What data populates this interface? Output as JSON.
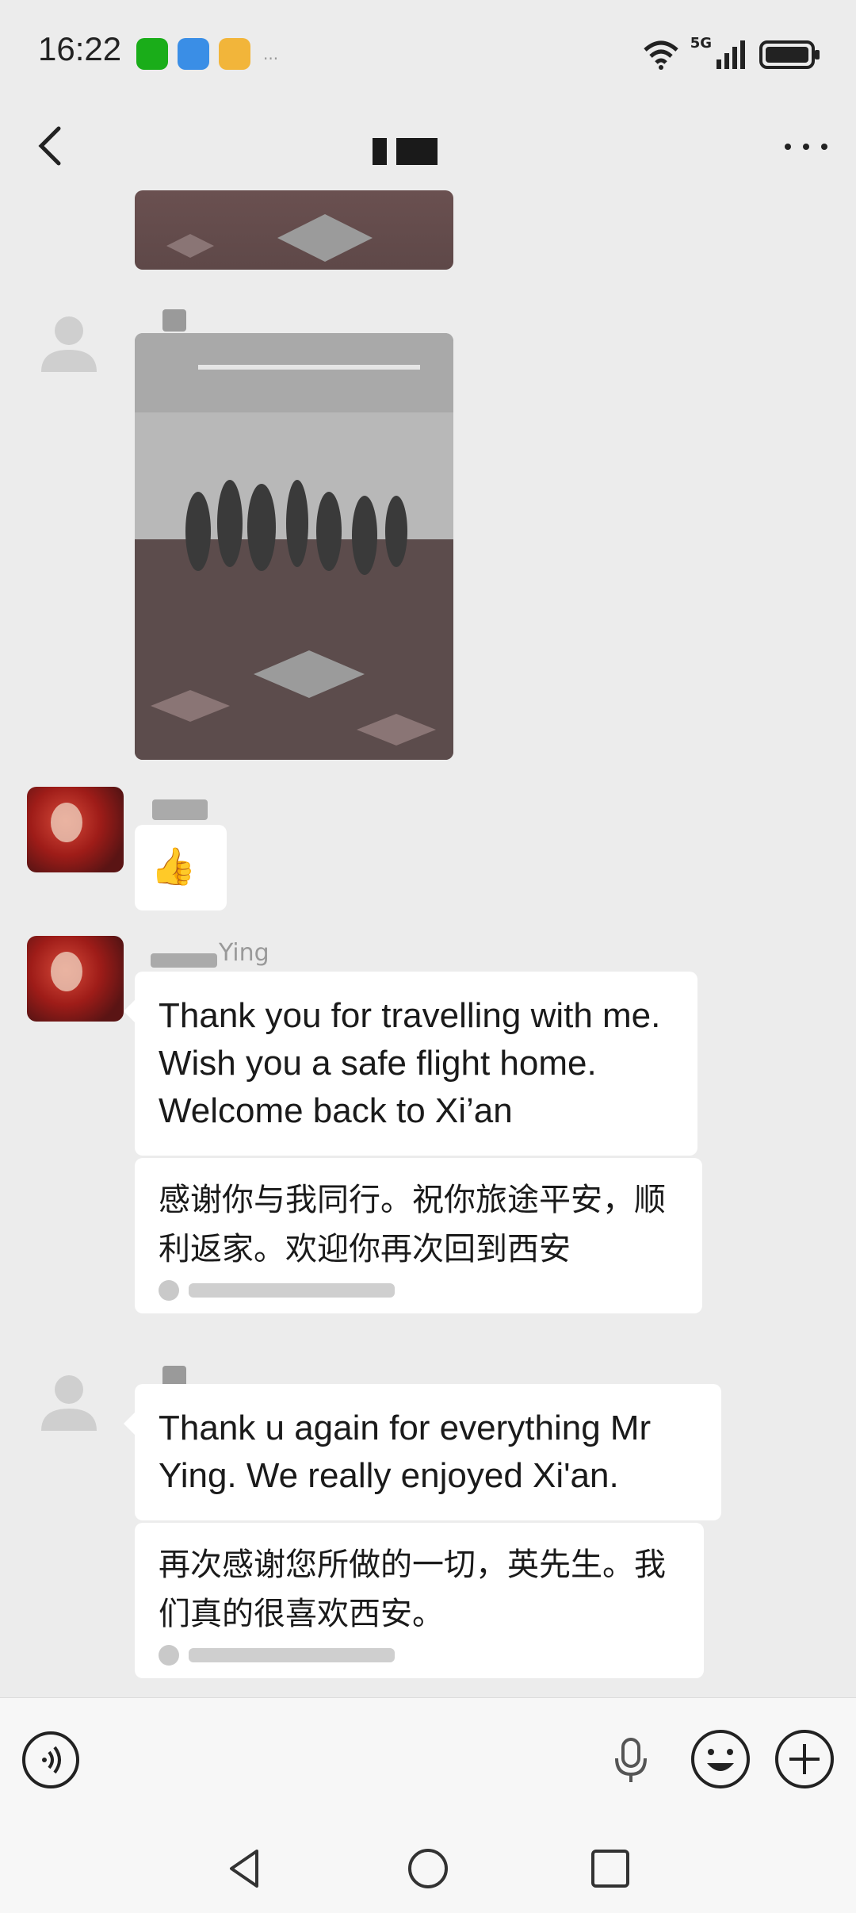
{
  "status_bar": {
    "time": "16:22",
    "network": "5G",
    "notification_icons": [
      "wechat-icon",
      "app-icon",
      "weather-icon"
    ],
    "colors": {
      "wechat": "#1aad19",
      "app": "#3a8ee6",
      "weather": "#f2b53a"
    }
  },
  "header": {
    "more_label": "more"
  },
  "messages": [
    {
      "type": "image",
      "sender": "other",
      "desc": "photo-partial"
    },
    {
      "type": "image",
      "sender": "contact"
    },
    {
      "type": "emoji",
      "sender": "user",
      "emoji": "👍"
    },
    {
      "type": "text",
      "sender": "user",
      "name": "Ying",
      "text": "Thank you for travelling with me. Wish you a safe flight home. Welcome back to Xi’an",
      "translation": "感谢你与我同行。祝你旅途平安，顺利返家。欢迎你再次回到西安"
    },
    {
      "type": "text",
      "sender": "contact",
      "text": "Thank u again for everything Mr Ying. We really enjoyed Xi'an.",
      "translation": "再次感谢您所做的一切，英先生。我们真的很喜欢西安。"
    }
  ]
}
